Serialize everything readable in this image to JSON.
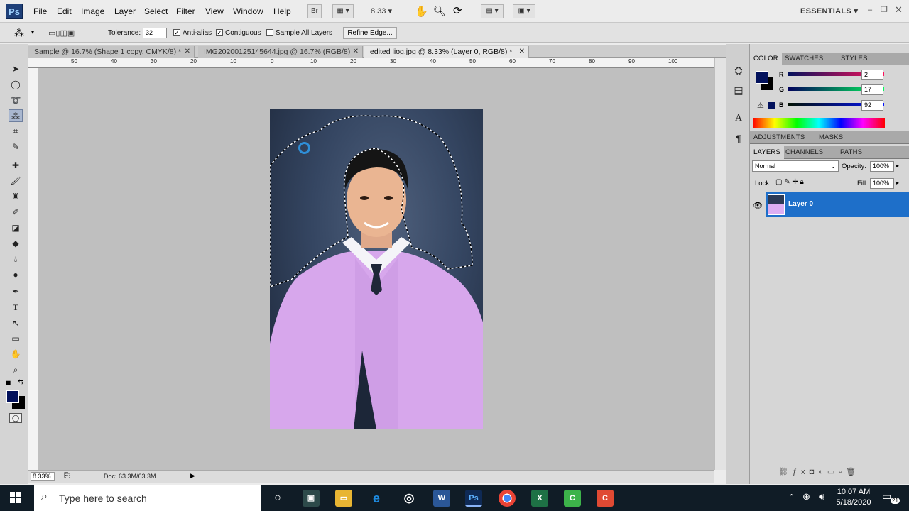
{
  "app": {
    "logo": "Ps"
  },
  "menu": [
    "File",
    "Edit",
    "Image",
    "Layer",
    "Select",
    "Filter",
    "View",
    "Window",
    "Help"
  ],
  "menubar_buttons": {
    "bridge": "Br",
    "zoom_level": "8.33",
    "workspace": "ESSENTIALS"
  },
  "options": {
    "tolerance_label": "Tolerance:",
    "tolerance_value": "32",
    "anti_alias": "Anti-alias",
    "contiguous": "Contiguous",
    "sample_all": "Sample All Layers",
    "refine_edge": "Refine Edge..."
  },
  "tabs": [
    {
      "label": "Sample @ 16.7% (Shape 1 copy, CMYK/8) *"
    },
    {
      "label": "IMG20200125145644.jpg @ 16.7% (RGB/8)"
    },
    {
      "label": "edited liog.jpg @ 8.33% (Layer 0, RGB/8) *"
    }
  ],
  "ruler_h_labels": [
    "50",
    "40",
    "30",
    "20",
    "10",
    "0",
    "10",
    "20",
    "30",
    "40",
    "50",
    "60",
    "70",
    "80",
    "90",
    "100"
  ],
  "status": {
    "zoom": "8.33%",
    "doc": "Doc: 63.3M/63.3M"
  },
  "color_panel": {
    "tabs": [
      "COLOR",
      "SWATCHES",
      "STYLES"
    ],
    "r_label": "R",
    "r_value": "2",
    "g_label": "G",
    "g_value": "17",
    "b_label": "B",
    "b_value": "92",
    "foreground": "#02115c"
  },
  "adjust_tabs": [
    "ADJUSTMENTS",
    "MASKS"
  ],
  "layers_panel": {
    "tabs": [
      "LAYERS",
      "CHANNELS",
      "PATHS"
    ],
    "blend_mode": "Normal",
    "opacity_label": "Opacity:",
    "opacity_value": "100%",
    "lock_label": "Lock:",
    "fill_label": "Fill:",
    "fill_value": "100%",
    "layer_name": "Layer 0"
  },
  "taskbar": {
    "search_placeholder": "Type here to search",
    "time": "10:07 AM",
    "date": "5/18/2020",
    "notifications": "21"
  }
}
